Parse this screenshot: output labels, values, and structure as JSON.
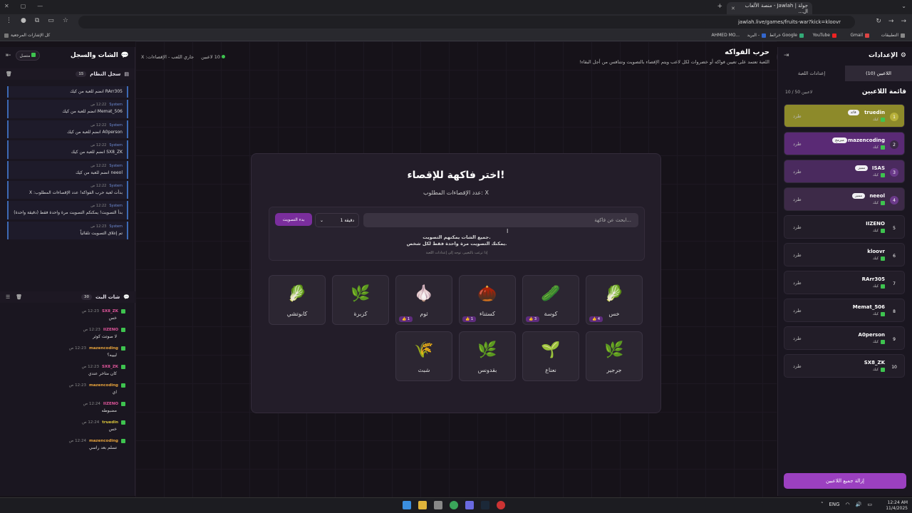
{
  "browser": {
    "tab_title": "جولة | Jawlah - منصة الألعاب ال...",
    "url": "jawlah.live/games/fruits-war?kick=kloovr",
    "bookmarks": [
      "التطبيقات",
      "Gmail",
      "YouTube",
      "خرائط Google",
      "البريد -",
      "AHMED MO...",
      "كل الإشارات المرجعية"
    ]
  },
  "left_panel": {
    "title": "الشات والسجل",
    "connection": "متصل",
    "system_log": {
      "title": "سجل النظام",
      "count": "15",
      "items": [
        {
          "user": "",
          "time": "",
          "msg": "RArr305 انضم للعبة من كيك"
        },
        {
          "user": "System",
          "time": "12:22 ص",
          "msg": "Memat_506 انضم للعبة من كيك"
        },
        {
          "user": "System",
          "time": "12:22 ص",
          "msg": "A0person انضم للعبة من كيك"
        },
        {
          "user": "System",
          "time": "12:22 ص",
          "msg": "SX8_ZK انضم للعبة من كيك"
        },
        {
          "user": "System",
          "time": "12:22 ص",
          "msg": "neeol انضم للعبة من كيك"
        },
        {
          "user": "System",
          "time": "12:22 ص",
          "msg": "بدأت لعبة حرب الفواكه! عدد الإقصاءات المطلوب: X"
        },
        {
          "user": "System",
          "time": "12:22 ص",
          "msg": "بدأ التصويت! يمكنكم التصويت مرة واحدة فقط (دقيقة واحدة)"
        },
        {
          "user": "System",
          "time": "12:23 ص",
          "msg": "تم إغلاق التصويت تلقائياً"
        }
      ]
    },
    "live_chat": {
      "title": "شات البث",
      "count": "30",
      "items": [
        {
          "user": "SX8_ZK",
          "color": "#e0569b",
          "time": "12:23 ص",
          "msg": "خس"
        },
        {
          "user": "IIZENO",
          "color": "#e0569b",
          "time": "12:23 ص",
          "msg": "لا صوتت كوثر"
        },
        {
          "user": "mazencoding",
          "color": "#e7a33b",
          "time": "12:23 ص",
          "msg": "ليييه؟"
        },
        {
          "user": "SX8_ZK",
          "color": "#e0569b",
          "time": "12:23 ص",
          "msg": "كان متاخر عندي"
        },
        {
          "user": "mazencoding",
          "color": "#e7a33b",
          "time": "12:23 ص",
          "msg": "اي"
        },
        {
          "user": "IIZENO",
          "color": "#e0569b",
          "time": "12:24 ص",
          "msg": "مضبوطه"
        },
        {
          "user": "truedin",
          "color": "#d8c43b",
          "time": "12:24 ص",
          "msg": "خس"
        },
        {
          "user": "mazencoding",
          "color": "#e7a33b",
          "time": "12:24 ص",
          "msg": "تسلم بعد راسي"
        }
      ]
    }
  },
  "main": {
    "title": "حرب الفواكه",
    "description": "اللعبة تعتمد على تعيين فواكه أو خضروات لكل لاعب ويتم الإقصاء بالتصويت وتتنافس من أجل البقاء!",
    "players_online": "10 لاعبين",
    "status": "جاري اللعب - الإقصاءات: X",
    "card": {
      "heading": "اختر فاكهة للإقصاء!",
      "subheading": "عدد الإقصاءات المطلوب: X",
      "search_placeholder": "ابحث عن فاكهة...",
      "duration": "1 دقيقة",
      "start_vote": "بدء التصويت",
      "note_line1": "جميع الشات يمكنهم التصويت.",
      "note_line2": "يمكنك التصويت مرة واحدة فقط لكل شخص.",
      "hint": "إذا ترغب بالتغيير، توجه إلى إعدادات اللعبة"
    },
    "fruits": [
      {
        "name": "خس",
        "icon": "lettuce",
        "glyph": "🥬",
        "badge": "4"
      },
      {
        "name": "كوسة",
        "icon": "zucchini",
        "glyph": "🥒",
        "badge": "3"
      },
      {
        "name": "كستناء",
        "icon": "chestnut",
        "glyph": "🌰",
        "badge": "1"
      },
      {
        "name": "ثوم",
        "icon": "garlic",
        "glyph": "🧄",
        "badge": "1"
      },
      {
        "name": "كزبرة",
        "icon": "coriander",
        "glyph": "🌿",
        "badge": ""
      },
      {
        "name": "كابوتشي",
        "icon": "cabbage",
        "glyph": "🥬",
        "badge": ""
      },
      {
        "name": "جرجير",
        "icon": "arugula",
        "glyph": "🌿",
        "badge": ""
      },
      {
        "name": "نعناع",
        "icon": "mint",
        "glyph": "🌱",
        "badge": ""
      },
      {
        "name": "بقدونس",
        "icon": "parsley",
        "glyph": "🌿",
        "badge": ""
      },
      {
        "name": "شبث",
        "icon": "dill",
        "glyph": "🌾",
        "badge": ""
      }
    ]
  },
  "right_panel": {
    "title": "الإعدادات",
    "tabs": [
      "اللاعبين (10)",
      "إعدادات اللعبة"
    ],
    "list_title": "قائمة اللاعبين",
    "list_count": "10 / 50 لاعبين",
    "kick_label": "طرد",
    "platform": "كيك",
    "players": [
      {
        "num": "1",
        "name": "truedin",
        "tag": "قائد",
        "bg": "#8d8a2a",
        "numbg": "#b7b03a"
      },
      {
        "num": "2",
        "name": "mazencoding",
        "tag": "مبرمج",
        "bg": "#5a2a75",
        "numbg": "#3a2a45"
      },
      {
        "num": "3",
        "name": "ISAS",
        "tag": "مميز",
        "bg": "#4a2a5e",
        "numbg": "#6b3a8a"
      },
      {
        "num": "4",
        "name": "neeol",
        "tag": "مميز",
        "bg": "#3d2a48",
        "numbg": "#6b3a8a"
      },
      {
        "num": "5",
        "name": "IIZENO",
        "tag": "",
        "bg": "#221d28",
        "numbg": ""
      },
      {
        "num": "6",
        "name": "kloovr",
        "tag": "",
        "bg": "#221d28",
        "numbg": ""
      },
      {
        "num": "7",
        "name": "RArr305",
        "tag": "",
        "bg": "#221d28",
        "numbg": ""
      },
      {
        "num": "8",
        "name": "Memat_506",
        "tag": "",
        "bg": "#221d28",
        "numbg": ""
      },
      {
        "num": "9",
        "name": "A0person",
        "tag": "",
        "bg": "#221d28",
        "numbg": ""
      },
      {
        "num": "10",
        "name": "SX8_ZK",
        "tag": "",
        "bg": "#221d28",
        "numbg": ""
      }
    ],
    "remove_all": "إزالة جميع اللاعبين"
  },
  "taskbar": {
    "time": "12:24 AM",
    "date": "11/4/2025",
    "lang": "ENG"
  }
}
